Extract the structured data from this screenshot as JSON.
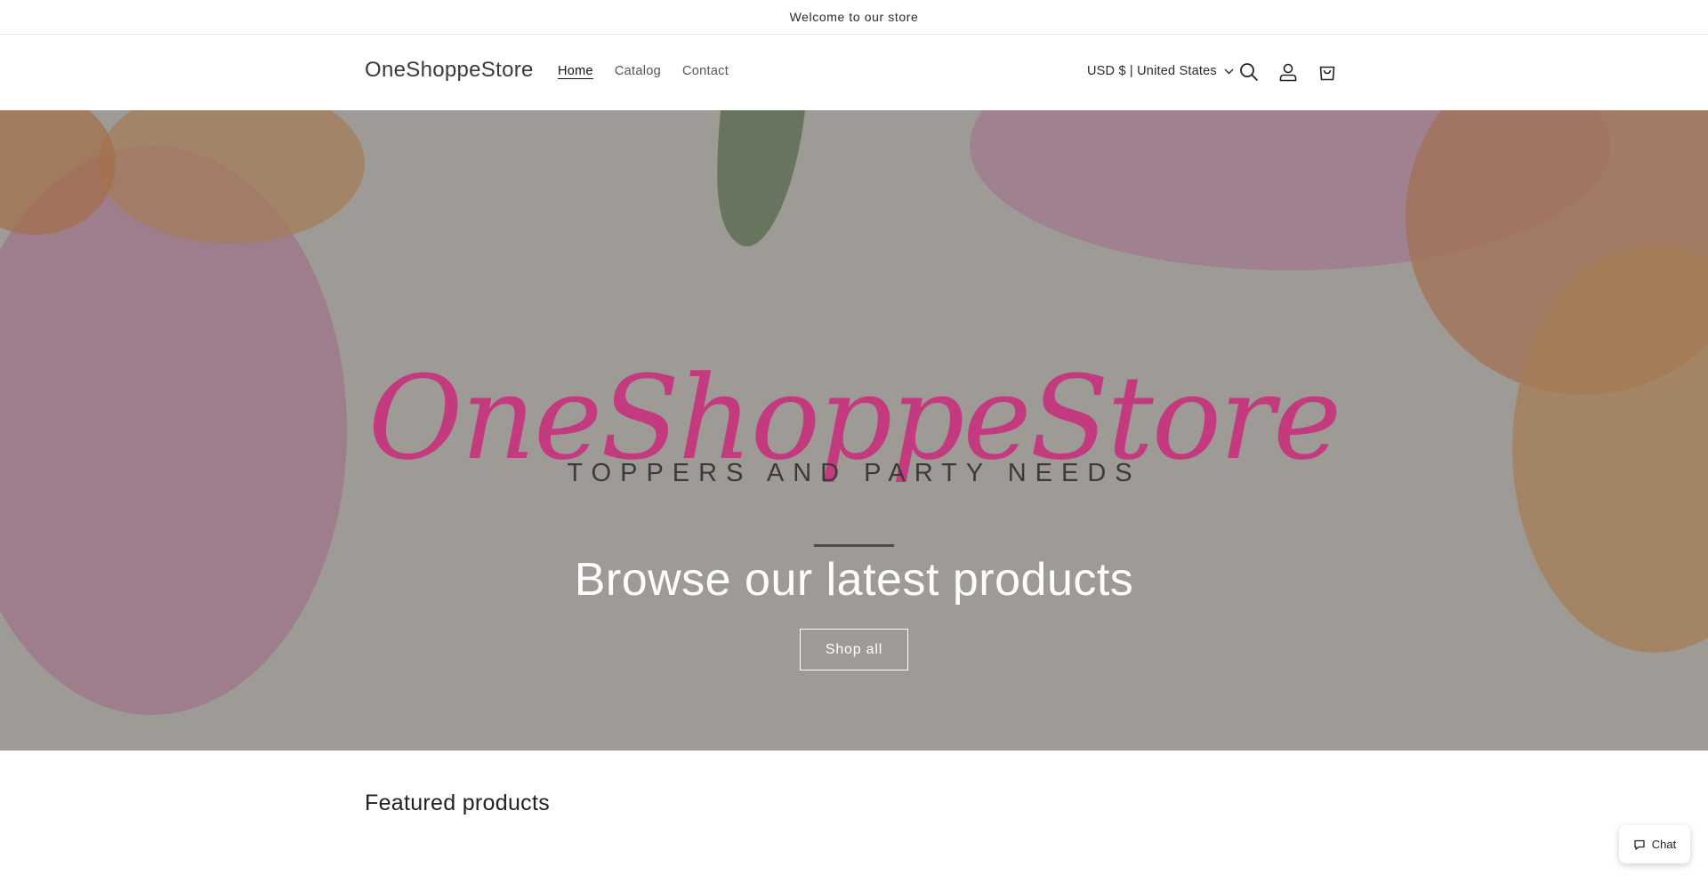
{
  "announcement": {
    "text": "Welcome to our store"
  },
  "header": {
    "logo": "OneShoppeStore",
    "nav": [
      {
        "label": "Home",
        "active": true
      },
      {
        "label": "Catalog",
        "active": false
      },
      {
        "label": "Contact",
        "active": false
      }
    ],
    "locale": "USD $ | United States",
    "icons": [
      "search-icon",
      "account-icon",
      "cart-icon"
    ]
  },
  "hero": {
    "brand_script": "OneShoppeStore",
    "brand_tagline": "TOPPERS AND PARTY NEEDS",
    "title": "Browse our latest products",
    "button": "Shop all"
  },
  "featured": {
    "heading": "Featured products"
  },
  "chat": {
    "label": "Chat"
  },
  "colors": {
    "brand_pink": "#c33a7e",
    "text": "#121212",
    "overlay": "#7a7570"
  }
}
